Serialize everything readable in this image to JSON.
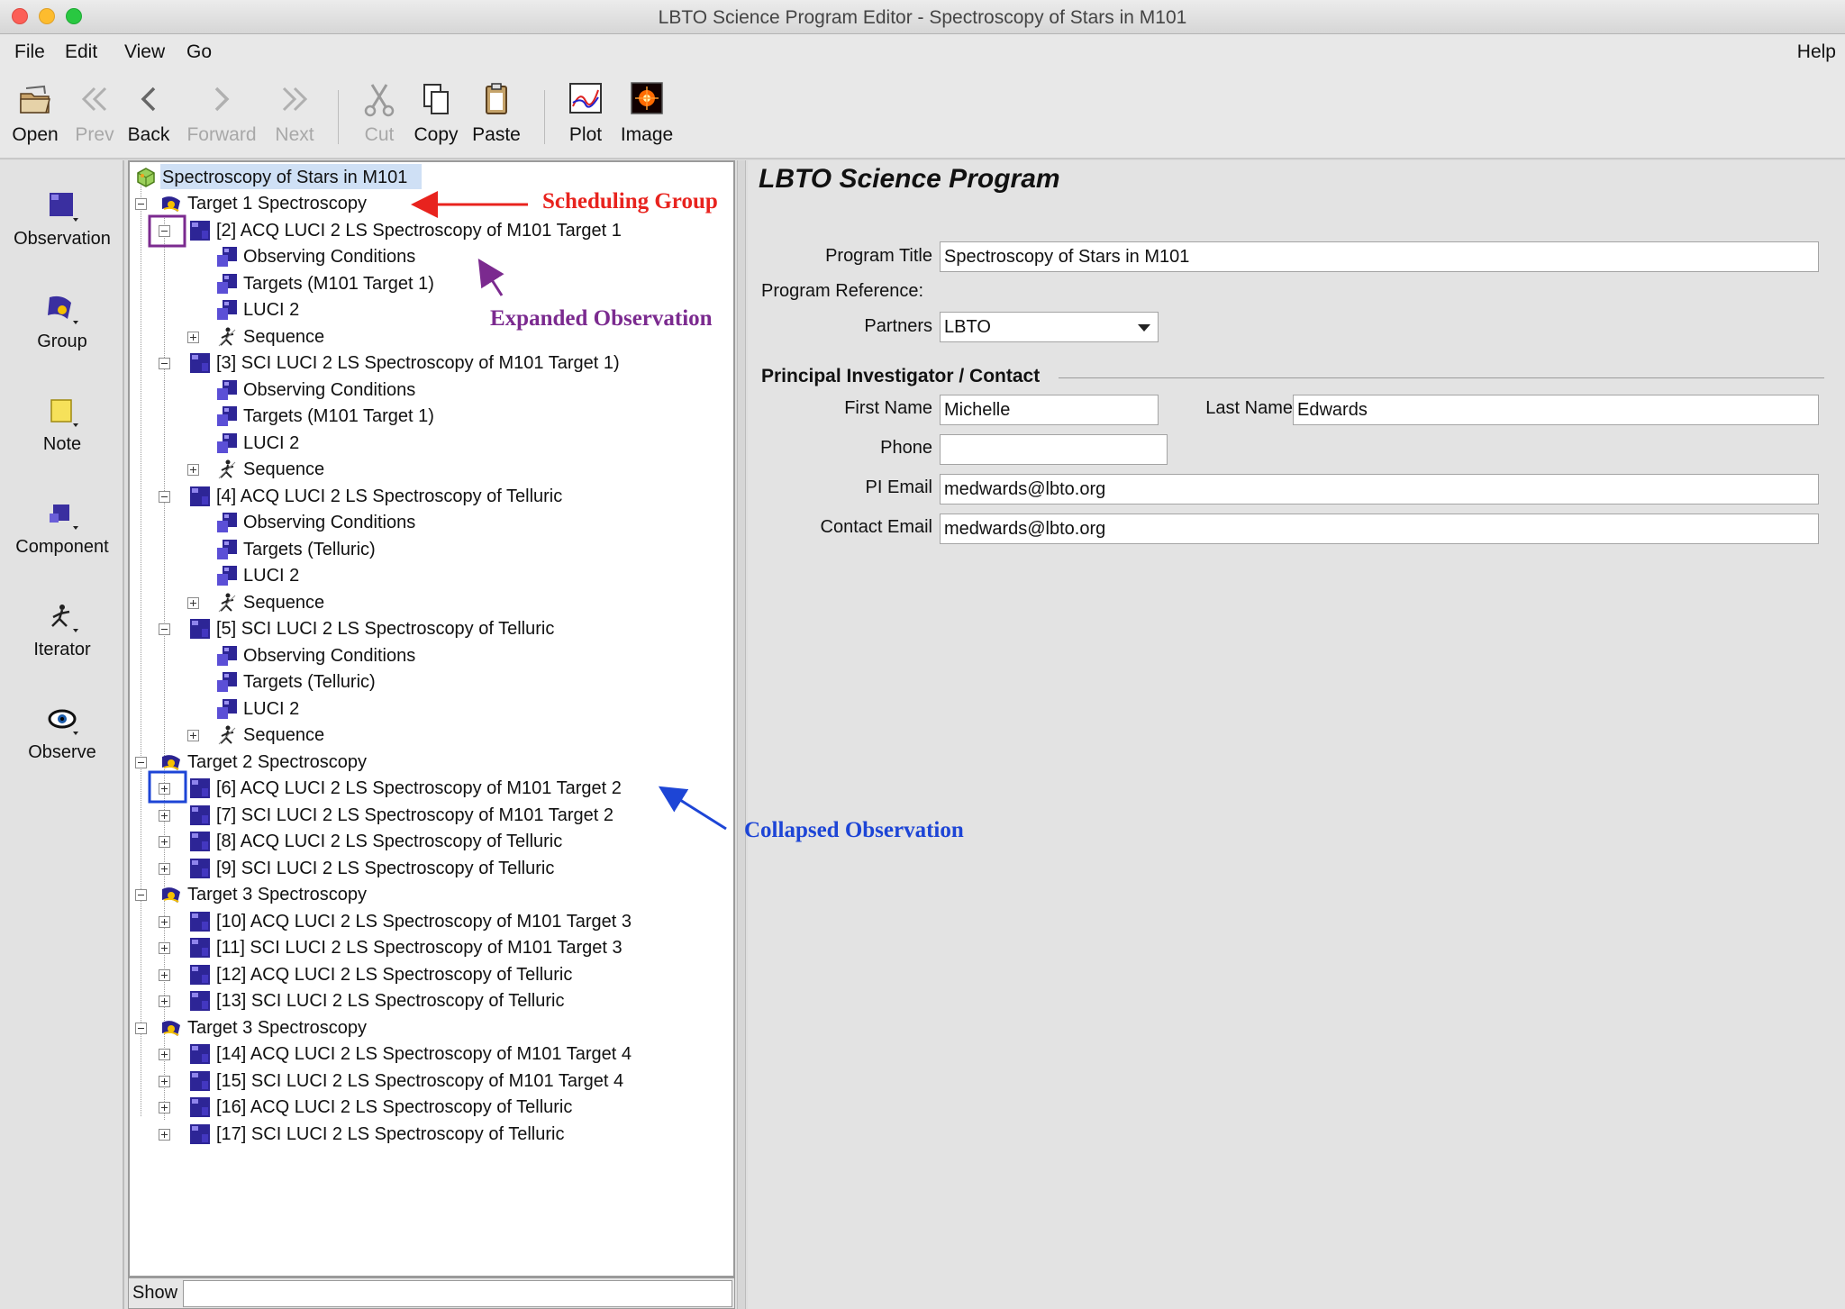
{
  "window": {
    "title": "LBTO Science Program Editor - Spectroscopy of Stars in M101"
  },
  "menu": {
    "items": [
      "File",
      "Edit",
      "View",
      "Go"
    ],
    "help": "Help"
  },
  "toolbar": {
    "open": "Open",
    "prev": "Prev",
    "back": "Back",
    "forward": "Forward",
    "next": "Next",
    "cut": "Cut",
    "copy": "Copy",
    "paste": "Paste",
    "plot": "Plot",
    "image": "Image"
  },
  "palette": {
    "observation": "Observation",
    "group": "Group",
    "note": "Note",
    "component": "Component",
    "iterator": "Iterator",
    "observe": "Observe"
  },
  "tree": {
    "root": "Spectroscopy of Stars in M101",
    "rows": [
      {
        "label": "Target 1 Spectroscopy",
        "kind": "group",
        "toggle": "minus"
      },
      {
        "label": "[2] ACQ LUCI 2 LS Spectroscopy of M101 Target 1",
        "kind": "obs",
        "toggle": "minus"
      },
      {
        "label": "Observing Conditions",
        "kind": "comp"
      },
      {
        "label": "Targets (M101 Target 1)",
        "kind": "comp"
      },
      {
        "label": "LUCI 2",
        "kind": "comp"
      },
      {
        "label": "Sequence",
        "kind": "seq",
        "toggle": "plus"
      },
      {
        "label": "[3] SCI LUCI 2 LS Spectroscopy of M101 Target 1)",
        "kind": "obs",
        "toggle": "minus"
      },
      {
        "label": "Observing Conditions",
        "kind": "comp"
      },
      {
        "label": "Targets (M101 Target 1)",
        "kind": "comp"
      },
      {
        "label": "LUCI 2",
        "kind": "comp"
      },
      {
        "label": "Sequence",
        "kind": "seq",
        "toggle": "plus"
      },
      {
        "label": "[4] ACQ LUCI 2 LS Spectroscopy of Telluric",
        "kind": "obs",
        "toggle": "minus"
      },
      {
        "label": "Observing Conditions",
        "kind": "comp"
      },
      {
        "label": "Targets (Telluric)",
        "kind": "comp"
      },
      {
        "label": "LUCI 2",
        "kind": "comp"
      },
      {
        "label": "Sequence",
        "kind": "seq",
        "toggle": "plus"
      },
      {
        "label": "[5] SCI LUCI 2 LS Spectroscopy of Telluric",
        "kind": "obs",
        "toggle": "minus"
      },
      {
        "label": "Observing Conditions",
        "kind": "comp"
      },
      {
        "label": "Targets (Telluric)",
        "kind": "comp"
      },
      {
        "label": "LUCI 2",
        "kind": "comp"
      },
      {
        "label": "Sequence",
        "kind": "seq",
        "toggle": "plus"
      },
      {
        "label": "Target 2 Spectroscopy",
        "kind": "group",
        "toggle": "minus"
      },
      {
        "label": "[6] ACQ LUCI 2 LS Spectroscopy of M101 Target 2",
        "kind": "obs",
        "toggle": "plus"
      },
      {
        "label": "[7] SCI LUCI 2 LS Spectroscopy of M101 Target 2",
        "kind": "obs",
        "toggle": "plus"
      },
      {
        "label": "[8] ACQ LUCI 2 LS Spectroscopy of Telluric",
        "kind": "obs",
        "toggle": "plus"
      },
      {
        "label": "[9] SCI LUCI 2 LS Spectroscopy of Telluric",
        "kind": "obs",
        "toggle": "plus"
      },
      {
        "label": "Target 3 Spectroscopy",
        "kind": "group",
        "toggle": "minus"
      },
      {
        "label": "[10] ACQ LUCI 2 LS Spectroscopy of M101 Target 3",
        "kind": "obs",
        "toggle": "plus"
      },
      {
        "label": "[11] SCI LUCI 2 LS Spectroscopy of M101 Target 3",
        "kind": "obs",
        "toggle": "plus"
      },
      {
        "label": "[12] ACQ LUCI 2 LS Spectroscopy of Telluric",
        "kind": "obs",
        "toggle": "plus"
      },
      {
        "label": "[13] SCI LUCI 2 LS Spectroscopy of Telluric",
        "kind": "obs",
        "toggle": "plus"
      },
      {
        "label": "Target 3 Spectroscopy",
        "kind": "group",
        "toggle": "minus"
      },
      {
        "label": "[14] ACQ LUCI 2 LS Spectroscopy of M101 Target 4",
        "kind": "obs",
        "toggle": "plus"
      },
      {
        "label": "[15] SCI LUCI 2 LS Spectroscopy of M101 Target 4",
        "kind": "obs",
        "toggle": "plus"
      },
      {
        "label": "[16] ACQ LUCI 2 LS Spectroscopy of Telluric",
        "kind": "obs",
        "toggle": "plus"
      },
      {
        "label": "[17] SCI LUCI 2 LS Spectroscopy of Telluric",
        "kind": "obs",
        "toggle": "plus"
      }
    ]
  },
  "show_bar": {
    "label": "Show",
    "value": ""
  },
  "form": {
    "heading": "LBTO Science Program",
    "program_title_label": "Program Title",
    "program_title_value": "Spectroscopy of Stars in M101",
    "program_reference_label": "Program Reference:",
    "partners_label": "Partners",
    "partners_value": "LBTO",
    "pi_heading": "Principal Investigator / Contact",
    "first_name_label": "First Name",
    "first_name_value": "Michelle",
    "last_name_label": "Last Name",
    "last_name_value": "Edwards",
    "phone_label": "Phone",
    "phone_value": "",
    "pi_email_label": "PI Email",
    "pi_email_value": "medwards@lbto.org",
    "contact_email_label": "Contact Email",
    "contact_email_value": "medwards@lbto.org"
  },
  "annotations": {
    "scheduling_group": "Scheduling Group",
    "expanded_observation": "Expanded Observation",
    "collapsed_observation": "Collapsed Observation",
    "colors": {
      "red": "#e8231e",
      "purple": "#7b2a8f",
      "blue": "#1d45d6"
    }
  },
  "icons": {
    "observation": "observation-icon",
    "group": "group-icon",
    "note": "note-icon",
    "component": "component-icon",
    "iterator": "iterator-icon",
    "observe": "eye-icon",
    "program": "program-icon"
  }
}
